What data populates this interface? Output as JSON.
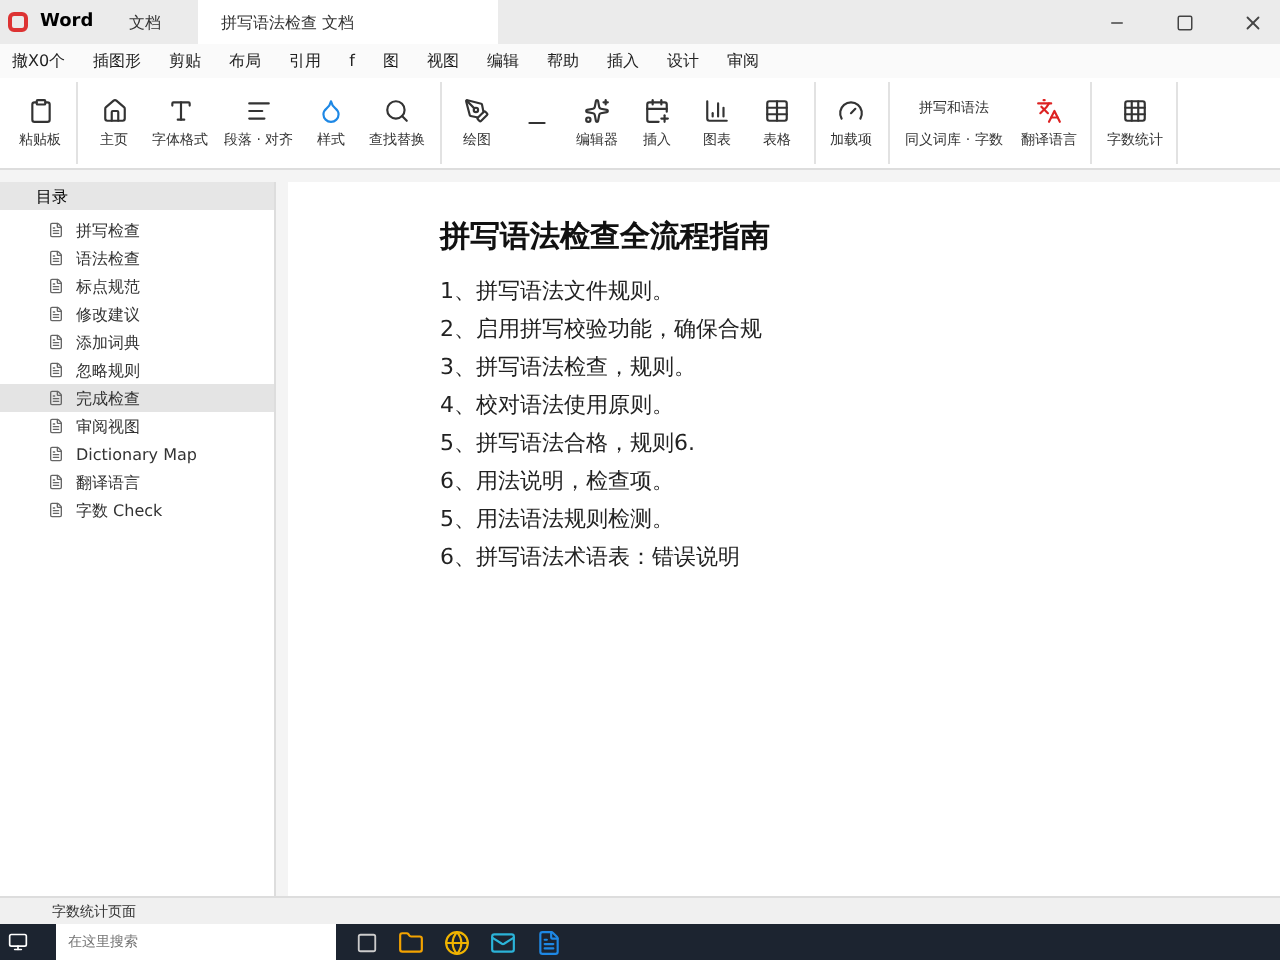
{
  "window": {
    "app_name": "Word",
    "doc_tabs": [
      {
        "label": "文档",
        "selected": false
      },
      {
        "label": "拼写语法检查 文档",
        "selected": true
      }
    ]
  },
  "menu": [
    "撤X0个",
    "插图形",
    "剪贴",
    "布局",
    "引用",
    "f",
    "图",
    "视图",
    "编辑",
    "帮助",
    "插入",
    "设计",
    "审阅"
  ],
  "ribbon": [
    [
      {
        "label": "粘贴板"
      }
    ],
    [
      {
        "label": "主页"
      },
      {
        "label": "字体格式"
      },
      {
        "label": "段落 · 对齐"
      },
      {
        "label": "样式"
      },
      {
        "label": "查找替换"
      }
    ],
    [
      {
        "label": "绘图"
      },
      {
        "kind": "icon"
      },
      {
        "label": "编辑器"
      },
      {
        "label": "插入"
      },
      {
        "label": "图表"
      },
      {
        "label": "表格"
      }
    ],
    [
      {
        "label": "加载项"
      }
    ],
    [
      {
        "label": "拼写和语法",
        "sub": "同义词库 · 字数"
      },
      {
        "label": "翻译语言"
      }
    ],
    [
      {
        "label": "字数统计"
      }
    ]
  ],
  "sidebar": {
    "title": "目录",
    "items": [
      {
        "label": "拼写检查",
        "selected": false
      },
      {
        "label": "语法检查",
        "selected": false
      },
      {
        "label": "标点规范",
        "selected": false
      },
      {
        "label": "修改建议",
        "selected": false
      },
      {
        "label": "添加词典",
        "selected": false
      },
      {
        "label": "忽略规则",
        "selected": false
      },
      {
        "label": "完成检查",
        "selected": true
      },
      {
        "label": "审阅视图",
        "selected": false
      },
      {
        "label": "Dictionary Map",
        "selected": false
      },
      {
        "label": "翻译语言",
        "selected": false
      },
      {
        "label": "字数 Check",
        "selected": false
      }
    ]
  },
  "document": {
    "heading": "拼写语法检查全流程指南",
    "items": [
      "1、拼写语法文件规则。",
      "2、启用拼写校验功能，确保合规",
      "3、拼写语法检查，规则。",
      "4、校对语法使用原则。",
      "5、拼写语法合格，规则6.",
      "6、用法说明，检查项。",
      "5、用法语法规则检测。",
      "6、拼写语法术语表：错误说明"
    ]
  },
  "status_bar": {
    "text": "字数统计页面"
  },
  "taskbar": {
    "search_placeholder": "在这里搜索"
  }
}
